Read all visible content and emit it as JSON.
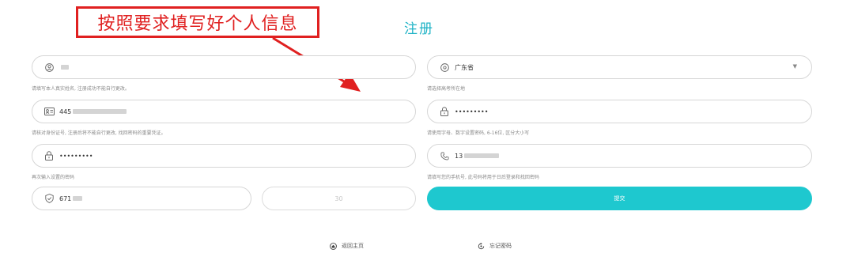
{
  "annotation": {
    "text": "按照要求填写好个人信息"
  },
  "page": {
    "title": "注册"
  },
  "form": {
    "name": {
      "value": "",
      "hint": "请填写本人真实姓名, 注册成功不能自行更改。"
    },
    "province": {
      "value": "广东省",
      "hint": "请选择高考所在地"
    },
    "id_number": {
      "value": "445",
      "hint": "请核对身份证号, 注册后将不能自行更改, 找回密码的重要凭证。"
    },
    "password": {
      "value": "•••••••••",
      "hint": "请使用字母、数字设置密码, 6-16位, 区分大小写"
    },
    "confirm_password": {
      "value": "•••••••••",
      "hint": "再次输入设置的密码"
    },
    "phone": {
      "value": "13",
      "hint": "请填写您的手机号, 此号码将用于日后登录和找回密码"
    },
    "verify_code": {
      "value": "671"
    },
    "countdown": "30",
    "submit_label": "提交"
  },
  "footer": {
    "home_link": "返回主页",
    "forgot_link": "忘记密码"
  },
  "colors": {
    "accent": "#1ec8cf",
    "annotation": "#e02020"
  }
}
